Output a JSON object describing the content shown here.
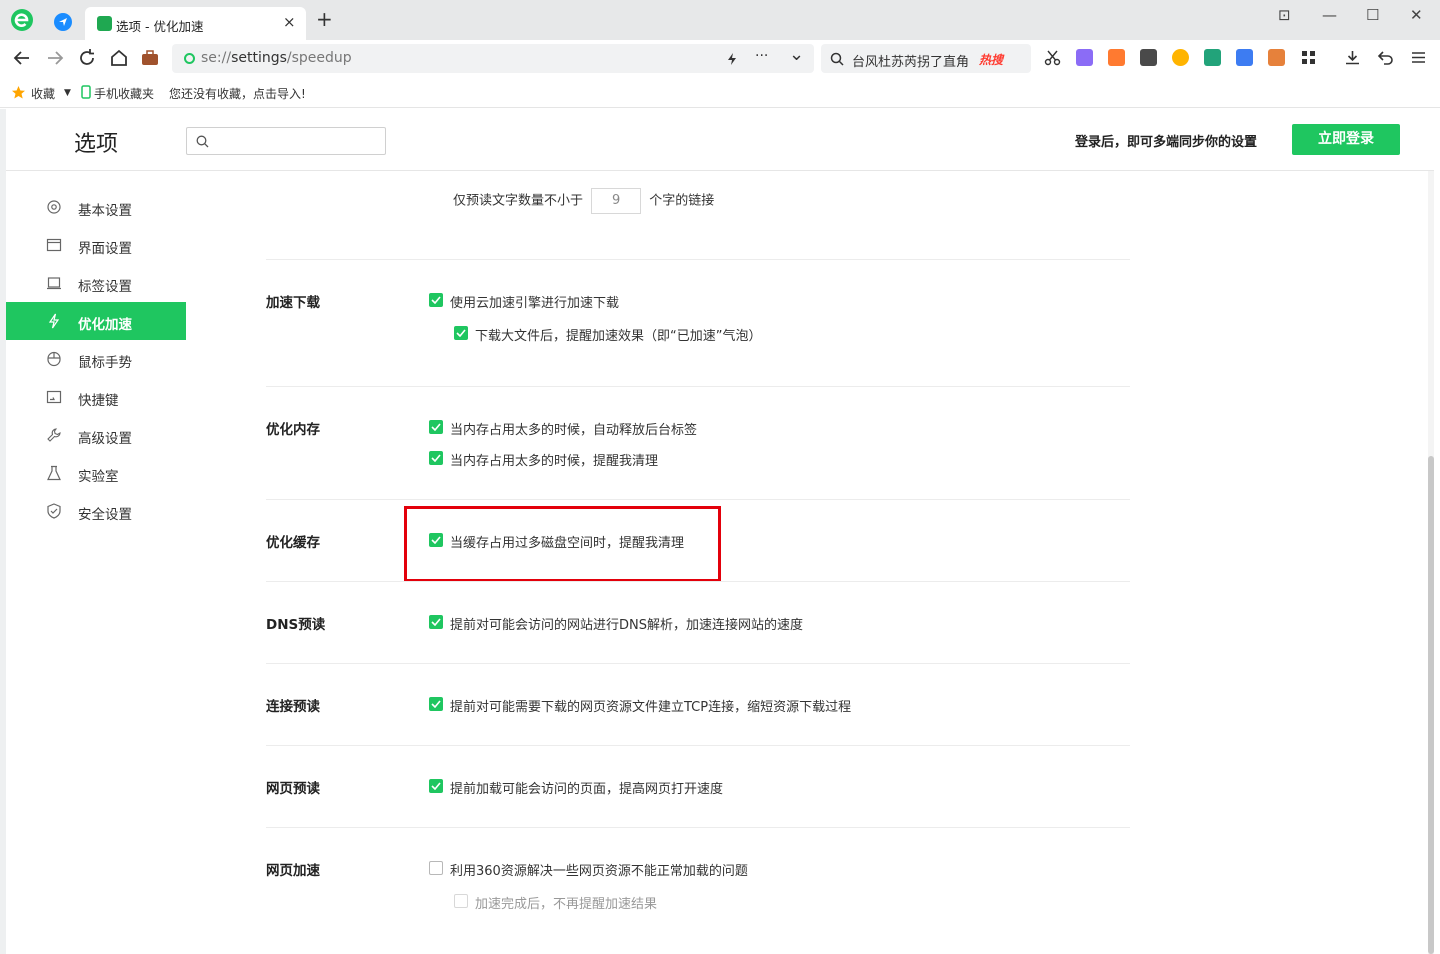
{
  "browser": {
    "tab_title": "选项 - 优化加速",
    "tab_close": "×",
    "new_tab": "+",
    "window": {
      "restore_icon": "⊡",
      "minimize": "—",
      "maximize": "☐",
      "close": "✕"
    }
  },
  "address_bar": {
    "url_scheme": "se://",
    "url_path": "settings",
    "url_rest": "/speedup",
    "more": "···",
    "dropdown": "⌄",
    "search_query": "台风杜苏芮拐了直角",
    "hot_label": "热搜"
  },
  "bookmarks": {
    "favorites": "收藏",
    "mobile": "手机收藏夹",
    "hint": "您还没有收藏，点击导入!"
  },
  "settings": {
    "title": "选项",
    "search_placeholder": "",
    "sync_text": "登录后，即可多端同步你的设置",
    "login_button": "立即登录",
    "sidebar": [
      {
        "label": "基本设置",
        "icon": "gear-icon"
      },
      {
        "label": "界面设置",
        "icon": "window-icon"
      },
      {
        "label": "标签设置",
        "icon": "tab-icon"
      },
      {
        "label": "优化加速",
        "icon": "lightning-icon",
        "active": true
      },
      {
        "label": "鼠标手势",
        "icon": "mouse-icon"
      },
      {
        "label": "快捷键",
        "icon": "keyboard-icon"
      },
      {
        "label": "高级设置",
        "icon": "wrench-icon"
      },
      {
        "label": "实验室",
        "icon": "flask-icon"
      },
      {
        "label": "安全设置",
        "icon": "shield-icon"
      }
    ],
    "prefetch": {
      "prefix": "仅预读文字数量不小于",
      "value": "9",
      "suffix": "个字的链接"
    },
    "sections": {
      "download": {
        "title": "加速下载",
        "opt1": "使用云加速引擎进行加速下载",
        "opt2": "下载大文件后，提醒加速效果（即“已加速”气泡）"
      },
      "memory": {
        "title": "优化内存",
        "opt1": "当内存占用太多的时候，自动释放后台标签",
        "opt2": "当内存占用太多的时候，提醒我清理"
      },
      "cache": {
        "title": "优化缓存",
        "opt1": "当缓存占用过多磁盘空间时，提醒我清理"
      },
      "dns": {
        "title": "DNS预读",
        "opt1": "提前对可能会访问的网站进行DNS解析，加速连接网站的速度"
      },
      "connect": {
        "title": "连接预读",
        "opt1": "提前对可能需要下载的网页资源文件建立TCP连接，缩短资源下载过程"
      },
      "page_prefetch": {
        "title": "网页预读",
        "opt1": "提前加载可能会访问的页面，提高网页打开速度"
      },
      "page_speedup": {
        "title": "网页加速",
        "opt1": "利用360资源解决一些网页资源不能正常加载的问题",
        "opt2": "加速完成后，不再提醒加速结果"
      }
    }
  },
  "colors": {
    "accent": "#1fc660",
    "highlight_box": "#e3000b"
  }
}
